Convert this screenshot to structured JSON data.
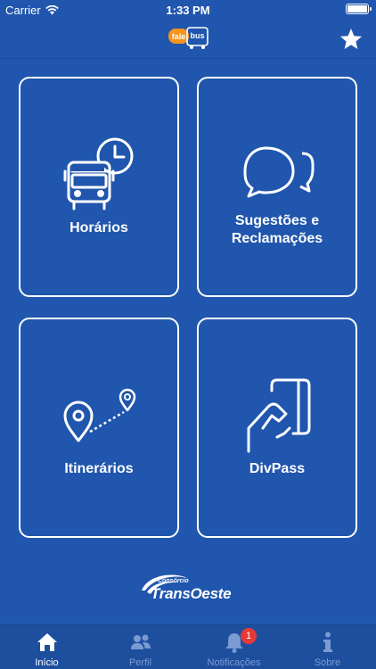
{
  "status_bar": {
    "carrier": "Carrier",
    "time": "1:33 PM"
  },
  "nav": {
    "logo_text": "fale bus",
    "star_icon": "star-icon"
  },
  "tiles": [
    {
      "label": "Horários",
      "icon": "bus-clock-icon"
    },
    {
      "label_line1": "Sugestões e",
      "label_line2": "Reclamações",
      "icon": "chat-bubbles-icon"
    },
    {
      "label": "Itinerários",
      "icon": "route-pins-icon"
    },
    {
      "label": "DivPass",
      "icon": "hand-card-icon"
    }
  ],
  "brand": {
    "small": "Consórcio",
    "name": "TransOeste"
  },
  "tabs": [
    {
      "label": "Início",
      "icon": "home-icon",
      "active": true
    },
    {
      "label": "Perfil",
      "icon": "people-icon"
    },
    {
      "label": "Notificações",
      "icon": "bell-icon",
      "badge": "1"
    },
    {
      "label": "Sobre",
      "icon": "info-icon"
    }
  ],
  "colors": {
    "background": "#2056ad",
    "tab_inactive": "#7a9bd1",
    "badge": "#e53935",
    "logo_orange": "#f7941d"
  }
}
